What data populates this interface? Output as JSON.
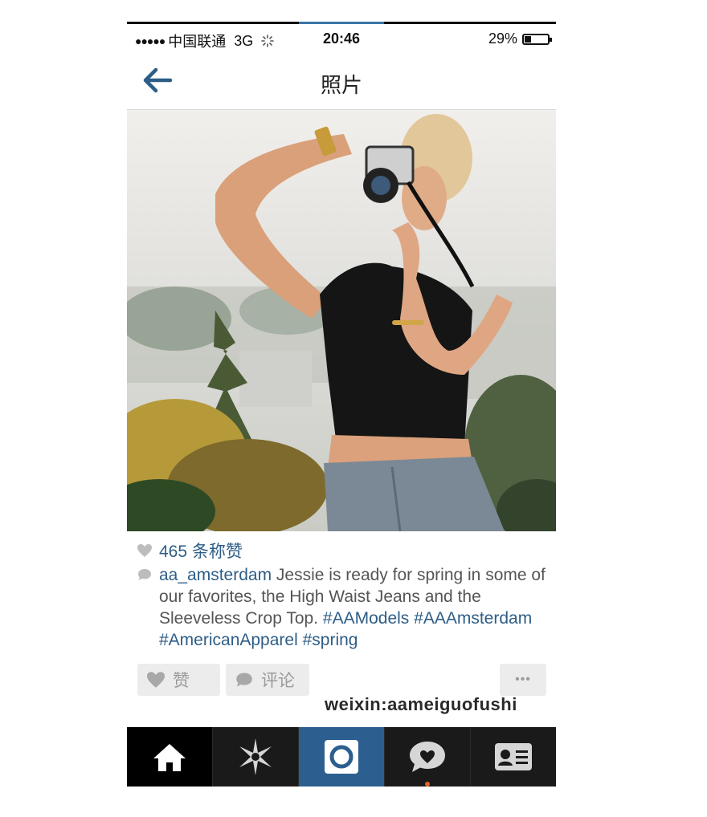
{
  "status_bar": {
    "signal": "●●●●●",
    "carrier": "中国联通",
    "network": "3G",
    "time": "20:46",
    "battery_percent": "29%",
    "battery_level": 0.29
  },
  "nav": {
    "title": "照片",
    "back_icon": "back-arrow-icon"
  },
  "post": {
    "likes": "465 条称赞",
    "username": "aa_amsterdam",
    "caption": "Jessie is ready for spring in some of our favorites, the High Waist Jeans and the Sleeveless Crop Top.",
    "hashtags": [
      "#AAModels",
      "#AAAmsterdam",
      "#AmericanApparel",
      "#spring"
    ]
  },
  "actions": {
    "like_label": "赞",
    "comment_label": "评论",
    "more_label": "•••"
  },
  "watermark": "weixin:aameiguofushi",
  "tabs": [
    {
      "name": "home",
      "icon": "home-icon"
    },
    {
      "name": "explore",
      "icon": "explore-star-icon"
    },
    {
      "name": "camera",
      "icon": "camera-icon"
    },
    {
      "name": "news",
      "icon": "heart-bubble-icon"
    },
    {
      "name": "profile",
      "icon": "profile-card-icon"
    }
  ],
  "colors": {
    "accent": "#2d5d86",
    "tabbar": "#1a1a1a",
    "active_tab": "#2c5f8f",
    "notification_dot": "#e8622c"
  }
}
